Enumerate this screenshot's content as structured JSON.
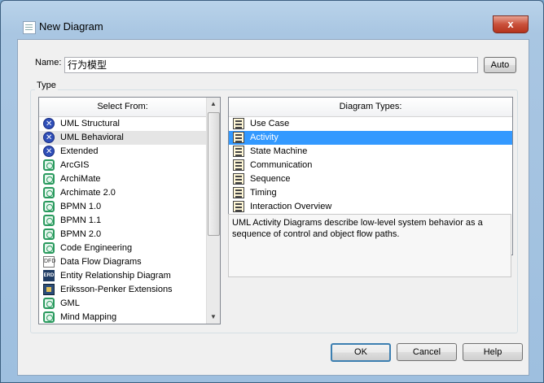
{
  "window": {
    "title": "New Diagram",
    "close_glyph": "x"
  },
  "name_field": {
    "label": "Name:",
    "value": "行为模型",
    "auto_button": "Auto"
  },
  "type_group": {
    "label": "Type"
  },
  "select_from": {
    "header": "Select From:",
    "items": [
      {
        "label": "UML Structural",
        "icon": "uml-icon",
        "state": "normal"
      },
      {
        "label": "UML Behavioral",
        "icon": "uml-icon",
        "state": "highlighted"
      },
      {
        "label": "Extended",
        "icon": "uml-icon",
        "state": "normal"
      },
      {
        "label": "ArcGIS",
        "icon": "bpmn-icon",
        "state": "normal"
      },
      {
        "label": "ArchiMate",
        "icon": "bpmn-icon",
        "state": "normal"
      },
      {
        "label": "Archimate 2.0",
        "icon": "bpmn-icon",
        "state": "normal"
      },
      {
        "label": "BPMN 1.0",
        "icon": "bpmn-icon",
        "state": "normal"
      },
      {
        "label": "BPMN 1.1",
        "icon": "bpmn-icon",
        "state": "normal"
      },
      {
        "label": "BPMN 2.0",
        "icon": "bpmn-icon",
        "state": "normal"
      },
      {
        "label": "Code Engineering",
        "icon": "bpmn-icon",
        "state": "normal"
      },
      {
        "label": "Data Flow Diagrams",
        "icon": "dfd-icon",
        "icon_text": "DFD",
        "state": "normal"
      },
      {
        "label": "Entity Relationship Diagram",
        "icon": "erd-icon",
        "icon_text": "ERD",
        "state": "normal"
      },
      {
        "label": "Eriksson-Penker Extensions",
        "icon": "ep-icon",
        "state": "normal"
      },
      {
        "label": "GML",
        "icon": "bpmn-icon",
        "state": "normal"
      },
      {
        "label": "Mind Mapping",
        "icon": "bpmn-icon",
        "state": "normal"
      }
    ]
  },
  "diagram_types": {
    "header": "Diagram Types:",
    "items": [
      {
        "label": "Use Case",
        "icon": "use-case-icon",
        "state": "normal"
      },
      {
        "label": "Activity",
        "icon": "activity-icon",
        "state": "selected"
      },
      {
        "label": "State Machine",
        "icon": "state-machine-icon",
        "state": "normal"
      },
      {
        "label": "Communication",
        "icon": "communication-icon",
        "state": "normal"
      },
      {
        "label": "Sequence",
        "icon": "sequence-icon",
        "state": "normal"
      },
      {
        "label": "Timing",
        "icon": "timing-icon",
        "state": "normal"
      },
      {
        "label": "Interaction Overview",
        "icon": "interaction-overview-icon",
        "state": "normal"
      }
    ]
  },
  "description": "UML Activity Diagrams describe low-level system behavior as a sequence of control and object flow paths.",
  "buttons": {
    "ok": "OK",
    "cancel": "Cancel",
    "help": "Help"
  },
  "colors": {
    "selection": "#3399ff",
    "highlight": "#e5e5e5",
    "uml_icon": "#2f4fb8",
    "bpmn_icon": "#2a9a5e"
  }
}
